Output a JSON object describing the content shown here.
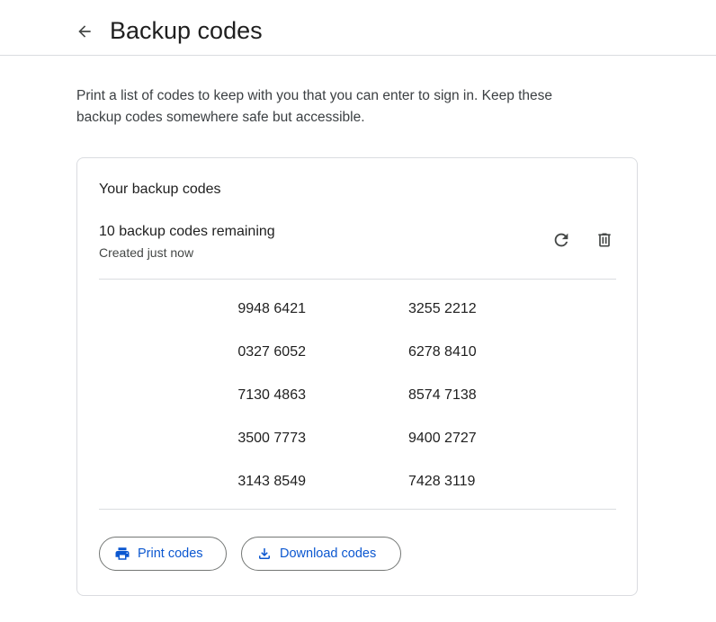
{
  "header": {
    "title": "Backup codes",
    "back_icon": "arrow-back-icon"
  },
  "intro": {
    "text": "Print a list of codes to keep with you that you can enter to sign in. Keep these backup codes somewhere safe but accessible."
  },
  "card": {
    "title": "Your backup codes",
    "remaining": "10 backup codes remaining",
    "created": "Created just now",
    "actions": {
      "refresh_icon": "refresh-icon",
      "delete_icon": "trash-icon"
    },
    "codes": [
      [
        "9948 6421",
        "3255 2212"
      ],
      [
        "0327 6052",
        "6278 8410"
      ],
      [
        "7130 4863",
        "8574 7138"
      ],
      [
        "3500 7773",
        "9400 2727"
      ],
      [
        "3143 8549",
        "7428 3119"
      ]
    ],
    "buttons": {
      "print_label": "Print codes",
      "download_label": "Download codes"
    }
  },
  "colors": {
    "accent": "#0b57d0",
    "text": "#1f1f1f",
    "border": "#dadce0"
  }
}
